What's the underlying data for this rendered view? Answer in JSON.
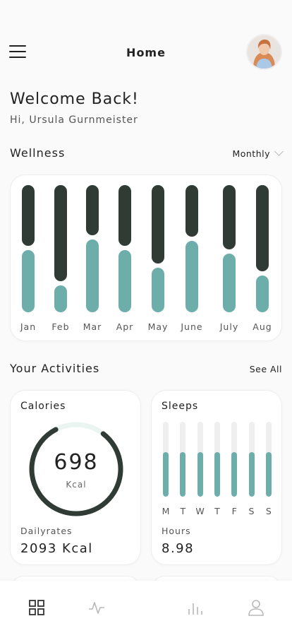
{
  "header": {
    "title": "Home",
    "menu_icon": "hamburger-menu-icon",
    "avatar": "user-avatar"
  },
  "welcome": {
    "title": "Welcome Back!",
    "greeting": "Hi, Ursula Gurnmeister"
  },
  "wellness": {
    "title": "Wellness",
    "period": "Monthly",
    "chart_data": {
      "type": "bar",
      "categories": [
        "Jan",
        "Feb",
        "Mar",
        "Apr",
        "May",
        "June",
        "July",
        "Aug"
      ],
      "series": [
        {
          "values": [
            0.49,
            0.21,
            0.57,
            0.49,
            0.35,
            0.56,
            0.46,
            0.29
          ]
        }
      ],
      "ylim": [
        0,
        1
      ],
      "colors": {
        "filled": "#6daeab",
        "remainder": "#2f3b34"
      }
    }
  },
  "activities": {
    "title": "Your Activities",
    "see_all": "See All",
    "calories": {
      "title": "Calories",
      "value": "698",
      "unit": "Kcal",
      "progress_fraction": 0.82,
      "daily_label": "Dailyrates",
      "daily_value": "2093 Kcal"
    },
    "sleeps": {
      "title": "Sleeps",
      "chart_data": {
        "type": "bar",
        "categories": [
          "M",
          "T",
          "W",
          "T",
          "F",
          "S",
          "S"
        ],
        "values": [
          0.59,
          0.59,
          0.59,
          0.59,
          0.59,
          0.59,
          0.59
        ],
        "ylim": [
          0,
          1
        ]
      },
      "hours_label": "Hours",
      "hours_value": "8.98"
    }
  },
  "tabbar": {
    "items": [
      "dashboard-grid-icon",
      "activity-pulse-icon",
      "stats-bars-icon",
      "profile-user-icon"
    ]
  },
  "colors": {
    "accent": "#6daeab",
    "dark": "#2f3b34",
    "track": "#efefef"
  }
}
